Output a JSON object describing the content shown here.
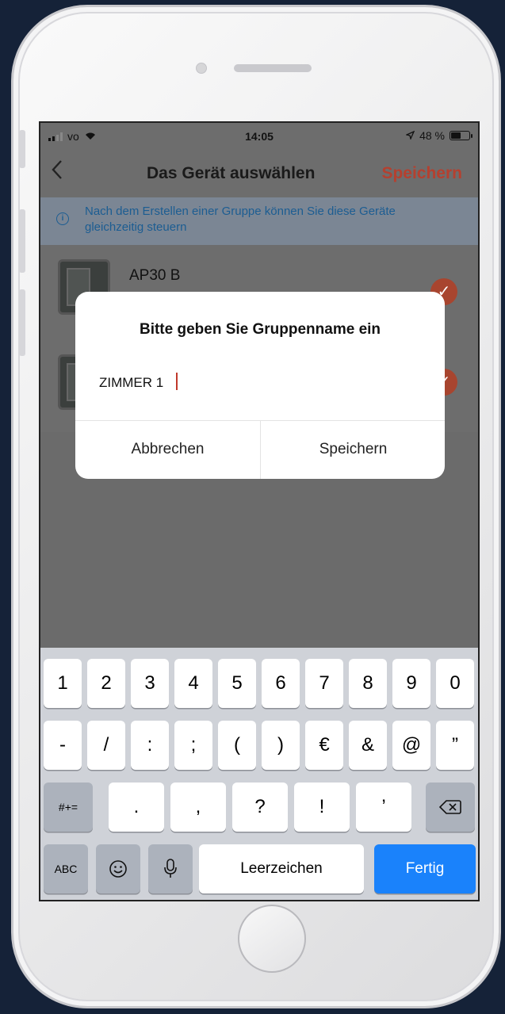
{
  "status": {
    "carrier": "vo",
    "time": "14:05",
    "battery": "48 %"
  },
  "nav": {
    "back_icon": "chevron-left-icon",
    "title": "Das Gerät auswählen",
    "save_label": "Speichern"
  },
  "banner": {
    "icon": "info-icon",
    "text": "Nach dem Erstellen einer Gruppe können Sie diese Geräte gleichzeitig steuern"
  },
  "devices": [
    {
      "name": "AP30 B",
      "selected": true
    },
    {
      "name": "",
      "selected": true
    }
  ],
  "dialog": {
    "title": "Bitte geben Sie Gruppenname ein",
    "input_value": "ZIMMER 1",
    "cancel_label": "Abbrechen",
    "save_label": "Speichern"
  },
  "keyboard": {
    "row1": [
      "1",
      "2",
      "3",
      "4",
      "5",
      "6",
      "7",
      "8",
      "9",
      "0"
    ],
    "row2": [
      "-",
      "/",
      ":",
      ";",
      "(",
      ")",
      "€",
      "&",
      "@",
      "”"
    ],
    "row3_mode": "#+=",
    "row3": [
      ".",
      ",",
      "?",
      "!",
      "’"
    ],
    "abc_label": "ABC",
    "space_label": "Leerzeichen",
    "done_label": "Fertig"
  },
  "colors": {
    "accent": "#b5402f",
    "keyboard_blue": "#1a82fb",
    "info_text": "#1c5d92"
  }
}
